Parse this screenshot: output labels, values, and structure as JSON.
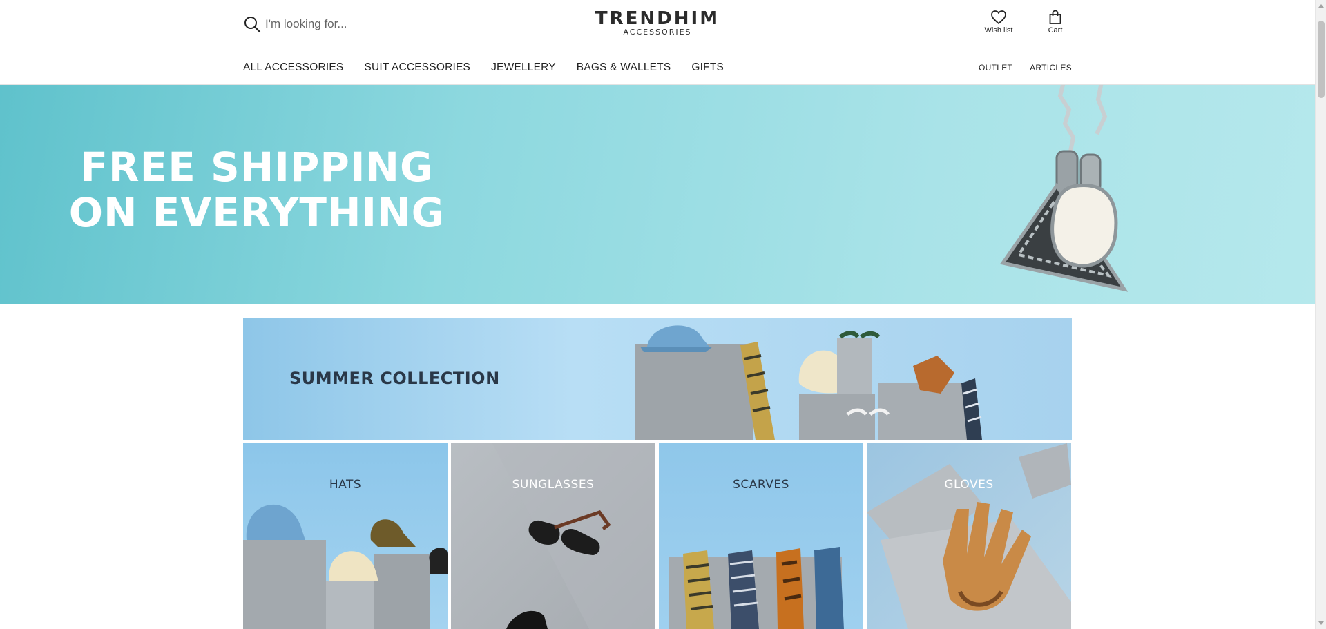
{
  "header": {
    "search": {
      "placeholder": "I'm looking for...",
      "icon": "search-icon"
    },
    "logo": {
      "brand": "TRENDHIM",
      "tagline": "ACCESSORIES"
    },
    "wishlist": {
      "label": "Wish list",
      "icon": "heart-icon"
    },
    "cart": {
      "label": "Cart",
      "icon": "shopping-bag-icon"
    }
  },
  "nav": {
    "left": [
      "ALL ACCESSORIES",
      "SUIT ACCESSORIES",
      "JEWELLERY",
      "BAGS & WALLETS",
      "GIFTS"
    ],
    "right": [
      "OUTLET",
      "ARTICLES"
    ]
  },
  "hero": {
    "line1": "FREE SHIPPING",
    "line2": "ON EVERYTHING",
    "background": "#8dd8df"
  },
  "summer": {
    "title": "SUMMER COLLECTION"
  },
  "categories": [
    {
      "label": "HATS"
    },
    {
      "label": "SUNGLASSES"
    },
    {
      "label": "SCARVES"
    },
    {
      "label": "GLOVES"
    }
  ]
}
